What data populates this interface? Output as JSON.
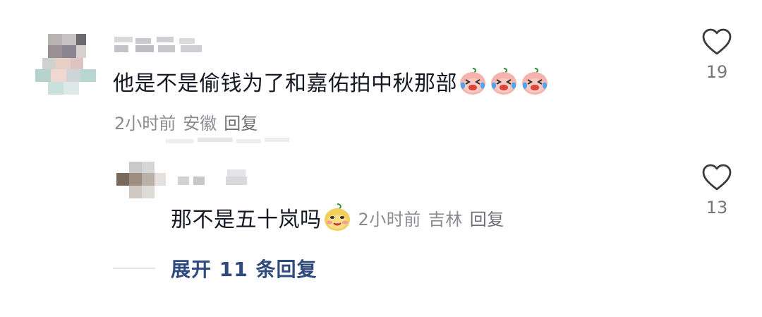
{
  "comment": {
    "text": "他是不是偷钱为了和嘉佑拍中秋那部",
    "emoji_icon": "crying-laughing-peach-emoji",
    "time": "2小时前",
    "location": "安徽",
    "reply_label": "回复",
    "like_count": "19"
  },
  "reply": {
    "text": "那不是五十岚吗",
    "emoji_icon": "sly-smile-peach-emoji",
    "time": "2小时前",
    "location": "吉林",
    "reply_label": "回复",
    "like_count": "13"
  },
  "expand": {
    "label": "展开 11 条回复"
  },
  "colors": {
    "text": "#161823",
    "meta": "#8a8b91",
    "link": "#2f4a7d",
    "icon": "#3a3a3f"
  }
}
